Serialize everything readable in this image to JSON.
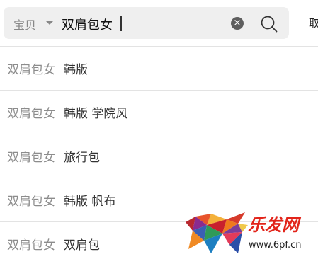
{
  "search": {
    "scope_label": "宝贝",
    "query": "双肩包女",
    "cancel_label": "取"
  },
  "suggestions": [
    {
      "prefix": "双肩包女",
      "suffix": "韩版"
    },
    {
      "prefix": "双肩包女",
      "suffix": "韩版 学院风"
    },
    {
      "prefix": "双肩包女",
      "suffix": "旅行包"
    },
    {
      "prefix": "双肩包女",
      "suffix": "韩版 帆布"
    },
    {
      "prefix": "双肩包女",
      "suffix": "双肩包"
    }
  ],
  "watermark": {
    "brand": "乐发网",
    "url": "www.6pf.cn"
  },
  "icons": {
    "scope": "chevron-down-icon",
    "clear": "clear-icon",
    "search": "search-icon"
  }
}
